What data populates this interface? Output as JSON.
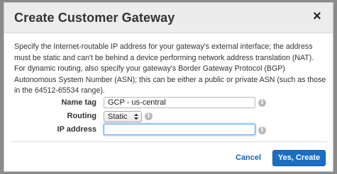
{
  "dialog": {
    "title": "Create Customer Gateway",
    "close_label": "×",
    "description": "Specify the Internet-routable IP address for your gateway's external interface; the address must be static and can't be behind a device performing network address translation (NAT). For dynamic routing, also specify your gateway's Border Gateway Protocol (BGP) Autonomous System Number (ASN); this can be either a public or private ASN (such as those in the 64512-65534 range)."
  },
  "form": {
    "name_tag": {
      "label": "Name tag",
      "value": "GCP - us-central",
      "info_icon": "info-icon"
    },
    "routing": {
      "label": "Routing",
      "selected": "Static",
      "info_icon": "info-icon"
    },
    "ip_address": {
      "label": "IP address",
      "value": "",
      "placeholder": "",
      "info_icon": "info-icon"
    }
  },
  "footer": {
    "cancel_label": "Cancel",
    "create_label": "Yes, Create"
  },
  "colors": {
    "primary_button": "#1a6fc4",
    "link": "#1a64b5",
    "focus_border": "#68a7e8"
  }
}
